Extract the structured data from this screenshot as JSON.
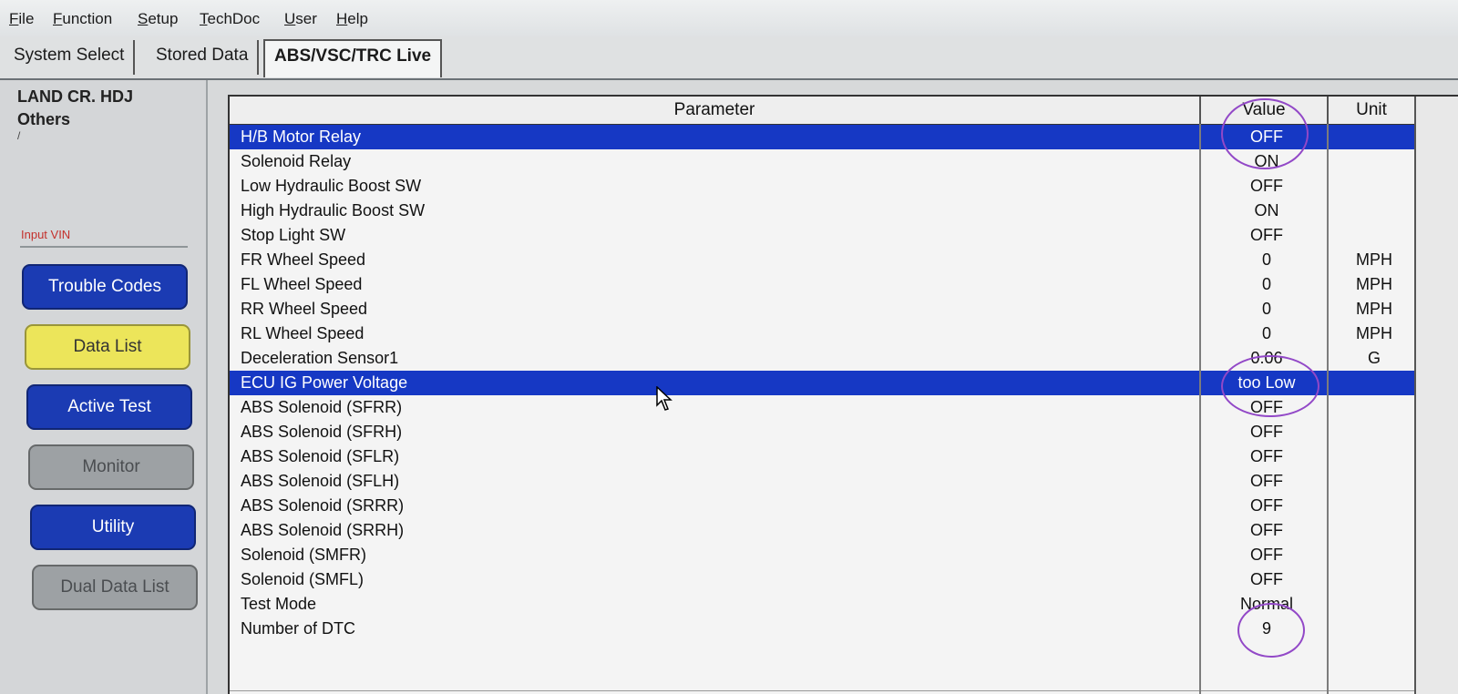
{
  "menu": [
    "File",
    "Function",
    "Setup",
    "TechDoc",
    "User",
    "Help"
  ],
  "tabs": [
    "System Select",
    "Stored Data",
    "ABS/VSC/TRC Live"
  ],
  "vehicle": {
    "name": "LAND CR. HDJ",
    "type": "Others",
    "mark": "/"
  },
  "input_vin_label": "Input VIN",
  "side_buttons": {
    "trouble_codes": "Trouble Codes",
    "data_list": "Data List",
    "active_test": "Active Test",
    "monitor": "Monitor",
    "utility": "Utility",
    "dual_data_list": "Dual Data List"
  },
  "table": {
    "headers": {
      "parameter": "Parameter",
      "value": "Value",
      "unit": "Unit"
    },
    "rows": [
      {
        "parameter": "H/B Motor Relay",
        "value": "OFF",
        "unit": ""
      },
      {
        "parameter": "Solenoid Relay",
        "value": "ON",
        "unit": ""
      },
      {
        "parameter": "Low Hydraulic Boost SW",
        "value": "OFF",
        "unit": ""
      },
      {
        "parameter": "High Hydraulic Boost SW",
        "value": "ON",
        "unit": ""
      },
      {
        "parameter": "Stop Light SW",
        "value": "OFF",
        "unit": ""
      },
      {
        "parameter": "FR Wheel Speed",
        "value": "0",
        "unit": "MPH"
      },
      {
        "parameter": "FL Wheel Speed",
        "value": "0",
        "unit": "MPH"
      },
      {
        "parameter": "RR Wheel Speed",
        "value": "0",
        "unit": "MPH"
      },
      {
        "parameter": "RL Wheel Speed",
        "value": "0",
        "unit": "MPH"
      },
      {
        "parameter": "Deceleration Sensor1",
        "value": "0.06",
        "unit": "G"
      },
      {
        "parameter": "ECU IG Power Voltage",
        "value": "too Low",
        "unit": ""
      },
      {
        "parameter": "ABS Solenoid (SFRR)",
        "value": "OFF",
        "unit": ""
      },
      {
        "parameter": "ABS Solenoid (SFRH)",
        "value": "OFF",
        "unit": ""
      },
      {
        "parameter": "ABS Solenoid (SFLR)",
        "value": "OFF",
        "unit": ""
      },
      {
        "parameter": "ABS Solenoid (SFLH)",
        "value": "OFF",
        "unit": ""
      },
      {
        "parameter": "ABS Solenoid (SRRR)",
        "value": "OFF",
        "unit": ""
      },
      {
        "parameter": "ABS Solenoid (SRRH)",
        "value": "OFF",
        "unit": ""
      },
      {
        "parameter": "Solenoid (SMFR)",
        "value": "OFF",
        "unit": ""
      },
      {
        "parameter": "Solenoid (SMFL)",
        "value": "OFF",
        "unit": ""
      },
      {
        "parameter": "Test Mode",
        "value": "Normal",
        "unit": ""
      },
      {
        "parameter": "Number of DTC",
        "value": "9",
        "unit": ""
      }
    ]
  },
  "colors": {
    "selection": "#1638c4",
    "annotation": "#9248c7",
    "button_blue": "#1b3bb3",
    "button_yellow": "#ece55a"
  }
}
